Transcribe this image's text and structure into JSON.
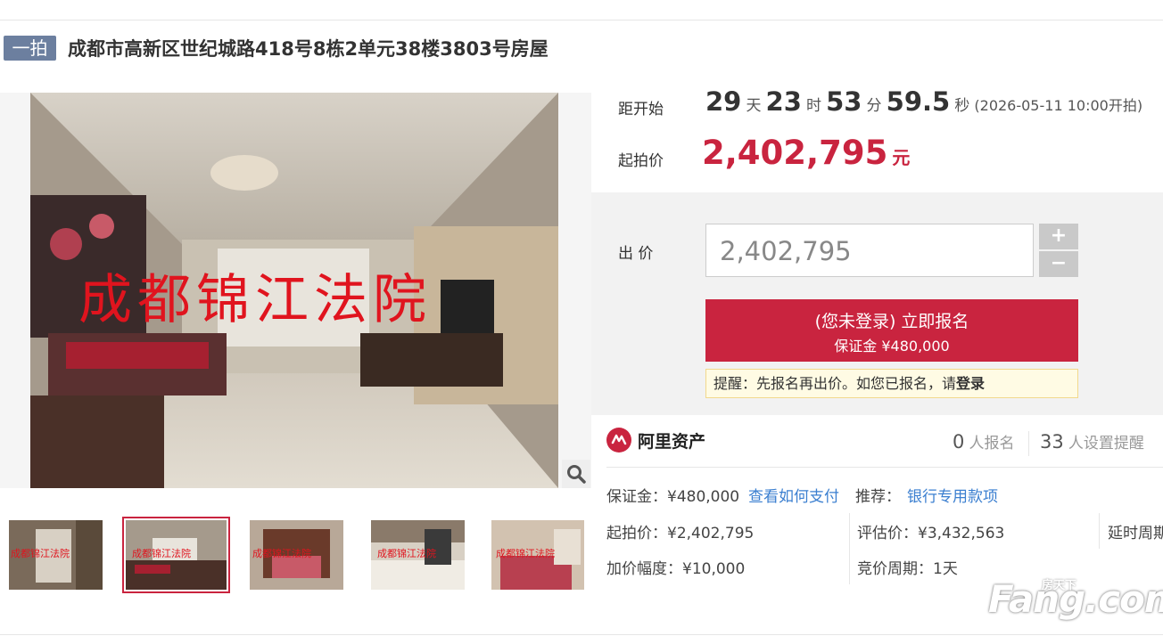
{
  "auction": {
    "badge": "一拍",
    "title": "成都市高新区世纪城路418号8栋2单元38楼3803号房屋"
  },
  "photo": {
    "watermark": "成都锦江法院",
    "thumb_watermark": "成都锦江法院"
  },
  "countdown": {
    "label": "距开始",
    "days": "29",
    "days_unit": "天",
    "hours": "23",
    "hours_unit": "时",
    "minutes": "53",
    "minutes_unit": "分",
    "seconds": "59.5",
    "seconds_unit": "秒",
    "start_note": "(2026-05-11 10:00开拍)"
  },
  "start_price": {
    "label": "起拍价",
    "value": "2,402,795",
    "unit": "元"
  },
  "bid": {
    "label": "出 价",
    "placeholder": "2,402,795",
    "plus": "+",
    "minus": "−",
    "signup_main": "(您未登录) 立即报名",
    "signup_deposit": "保证金 ¥480,000",
    "tip_prefix": "提醒：先报名再出价。如您已报名，请",
    "tip_login": "登录"
  },
  "platform": {
    "name": "阿里资产",
    "signups_count": "0",
    "signups_label": "人报名",
    "reminders_count": "33",
    "reminders_label": "人设置提醒"
  },
  "details": {
    "deposit": "保证金：¥480,000",
    "how_to_pay": "查看如何支付",
    "recommend_label": "推荐：",
    "recommend_link": "银行专用款项",
    "start_price": "起拍价：¥2,402,795",
    "appraisal": "评估价：¥3,432,563",
    "delay": "延时周期",
    "increment": "加价幅度：¥10,000",
    "cycle": "竞价周期：1天"
  },
  "logo": {
    "text": "Fang.com",
    "cn": "房天下"
  },
  "colors": {
    "accent": "#c9243f",
    "link": "#3b7fd0",
    "badge": "#6c7f9f"
  }
}
